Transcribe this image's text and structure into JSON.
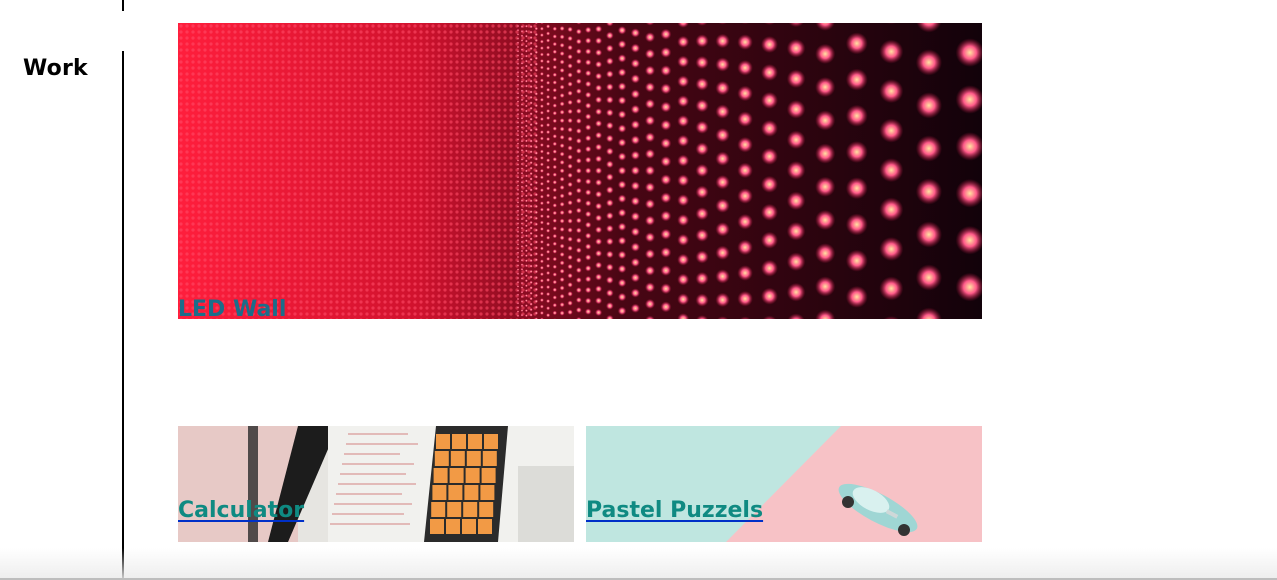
{
  "sidebar": {
    "heading": "Work"
  },
  "projects": [
    {
      "title": "LED Wall",
      "image": "led-wall-photo"
    },
    {
      "title": "Calculator",
      "image": "calculator-laptop-photo"
    },
    {
      "title": "Pastel Puzzels",
      "image": "pastel-toy-car-photo"
    }
  ],
  "colors": {
    "link_text": "#0f8a82",
    "link_underline": "#0030c8",
    "rule": "#000000",
    "led_red": "#ff2a4a",
    "pastel_mint": "#bfe6e0",
    "pastel_pink": "#f7c2c6",
    "calculator_orange": "#f29a45"
  }
}
